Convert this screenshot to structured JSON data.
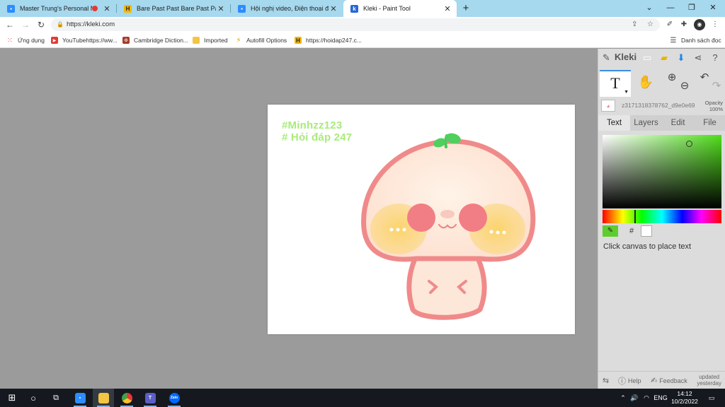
{
  "tabs": [
    {
      "label": "Master Trung's Personal Mee",
      "favicon": "zoom-icon",
      "color": "#2d8cff"
    },
    {
      "label": "Bare Past Past Bare Past Past Forc",
      "favicon": "h-icon",
      "color": "#f2b705"
    },
    {
      "label": "Hội nghị video, Điện thoại đám m",
      "favicon": "zoom-icon",
      "color": "#2d8cff"
    },
    {
      "label": "Kleki - Paint Tool",
      "favicon": "kleki-icon",
      "color": "#2667d6"
    }
  ],
  "address": {
    "url": "https://kleki.com"
  },
  "bookmarks": [
    {
      "label": "Ứng dụng",
      "icon": "apps-grid-icon"
    },
    {
      "label": "YouTubehttps://ww...",
      "icon": "youtube-icon"
    },
    {
      "label": "Cambridge Diction...",
      "icon": "cambridge-icon"
    },
    {
      "label": "Imported",
      "icon": "folder-icon"
    },
    {
      "label": "Autofill Options",
      "icon": "autofill-icon"
    },
    {
      "label": "https://hoidap247.c...",
      "icon": "h-icon"
    }
  ],
  "reading_list": "Danh sách đọc",
  "canvas": {
    "text_line1": "#Minhzz123",
    "text_line2": "# Hỏi đáp 247"
  },
  "panel": {
    "logo": "Kleki",
    "layer_name": "z3171318378762_d9e0e69",
    "opacity_label": "Opacity",
    "opacity_value": "100%",
    "tabs": [
      "Text",
      "Layers",
      "Edit",
      "File"
    ],
    "active_tab": "Text",
    "color_hex_symbol": "#",
    "hint": "Click canvas to place text",
    "footer": {
      "help": "Help",
      "feedback": "Feedback",
      "updated_line1": "updated",
      "updated_line2": "yesterday"
    },
    "colors": {
      "selected": "#5fcc2f",
      "secondary": "#ffffff"
    }
  },
  "taskbar": {
    "language": "ENG",
    "time": "14:12",
    "date": "10/2/2022"
  }
}
